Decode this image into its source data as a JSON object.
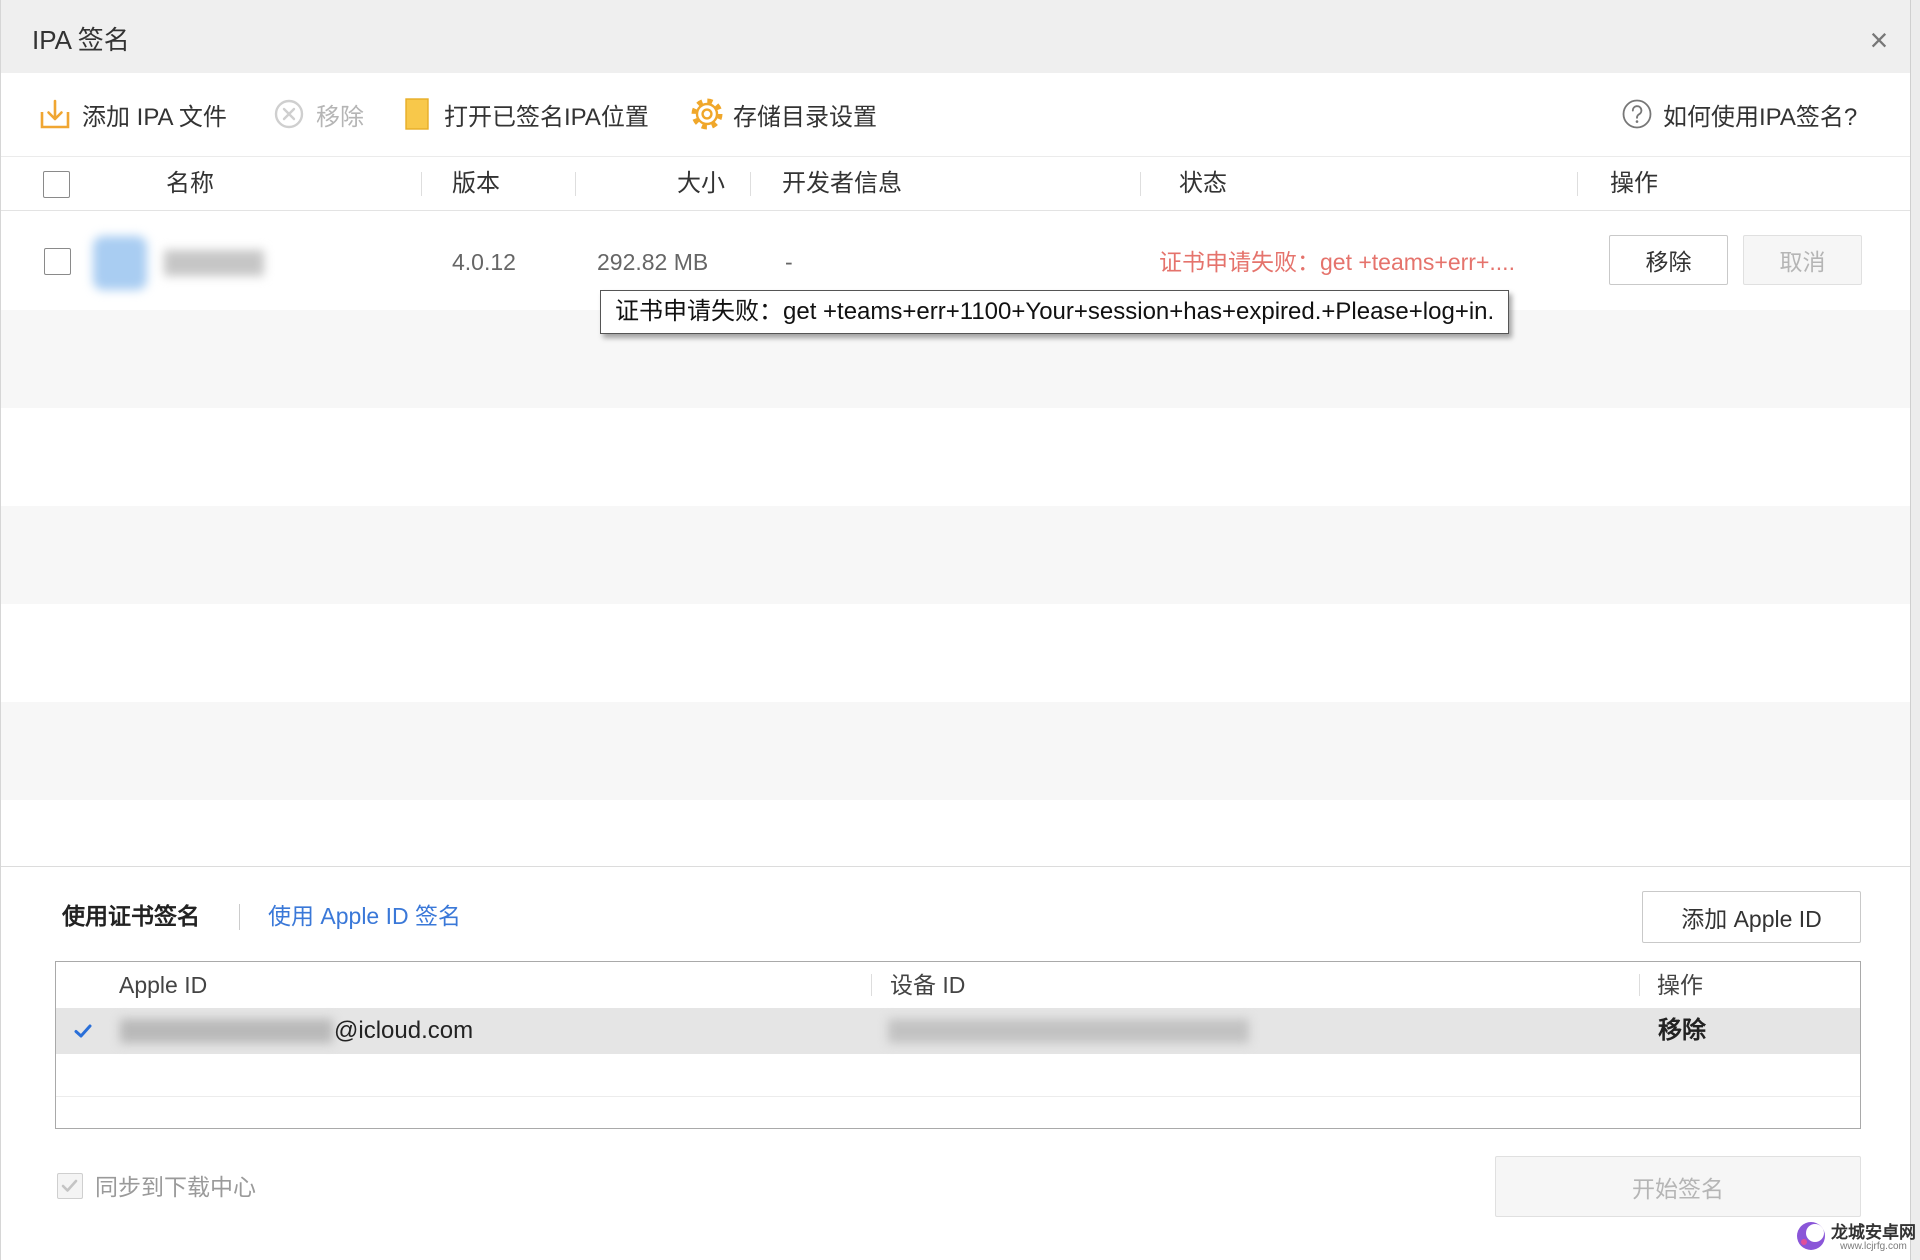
{
  "window": {
    "title": "IPA 签名",
    "close_glyph": "×",
    "close_icon": "close-icon"
  },
  "toolbar": {
    "add_ipa_label": "添加 IPA 文件",
    "remove_label": "移除",
    "remove_disabled": true,
    "open_signed_location_label": "打开已签名IPA位置",
    "storage_settings_label": "存储目录设置",
    "help_label": "如何使用IPA签名?",
    "icons": {
      "add_ipa": "add-file-icon",
      "remove": "remove-circle-icon",
      "open_signed_location": "folder-icon",
      "storage_settings": "gear-icon",
      "help": "question-circle-icon"
    }
  },
  "ipa_table": {
    "columns": {
      "name": "名称",
      "version": "版本",
      "size": "大小",
      "developer": "开发者信息",
      "status": "状态",
      "actions": "操作"
    },
    "rows": [
      {
        "checked": false,
        "version": "4.0.12",
        "size": "292.82 MB",
        "developer": "-",
        "status": "证书申请失败：get +teams+err+....",
        "remove_label": "移除",
        "cancel_label": "取消",
        "cancel_disabled": true
      }
    ]
  },
  "tooltip": {
    "text": "证书申请失败：get +teams+err+1100+Your+session+has+expired.+Please+log+in."
  },
  "sign_mode": {
    "tabs": [
      {
        "label": "使用证书签名",
        "active": false
      },
      {
        "label": "使用 Apple ID 签名",
        "active": true
      }
    ],
    "add_apple_id_label": "添加 Apple ID"
  },
  "apple_id_table": {
    "columns": {
      "apple_id": "Apple ID",
      "device_id": "设备 ID",
      "actions": "操作"
    },
    "rows": [
      {
        "selected": true,
        "email_suffix": "@icloud.com",
        "remove_label": "移除"
      }
    ]
  },
  "footer": {
    "sync_label": "同步到下载中心",
    "sync_checked": true,
    "sync_disabled": true,
    "start_sign_label": "开始签名",
    "start_sign_disabled": true
  },
  "watermark": {
    "name": "龙城安卓网",
    "url": "www.lcjrfg.com"
  },
  "colors": {
    "accent_blue": "#3a78d8",
    "error_red": "#e5736c",
    "check_blue": "#2a6fd8",
    "add_icon": "#f0a632",
    "folder_icon": "#f8c84a",
    "gear_icon": "#f0a72a",
    "disabled_text": "#b5b5b5"
  }
}
